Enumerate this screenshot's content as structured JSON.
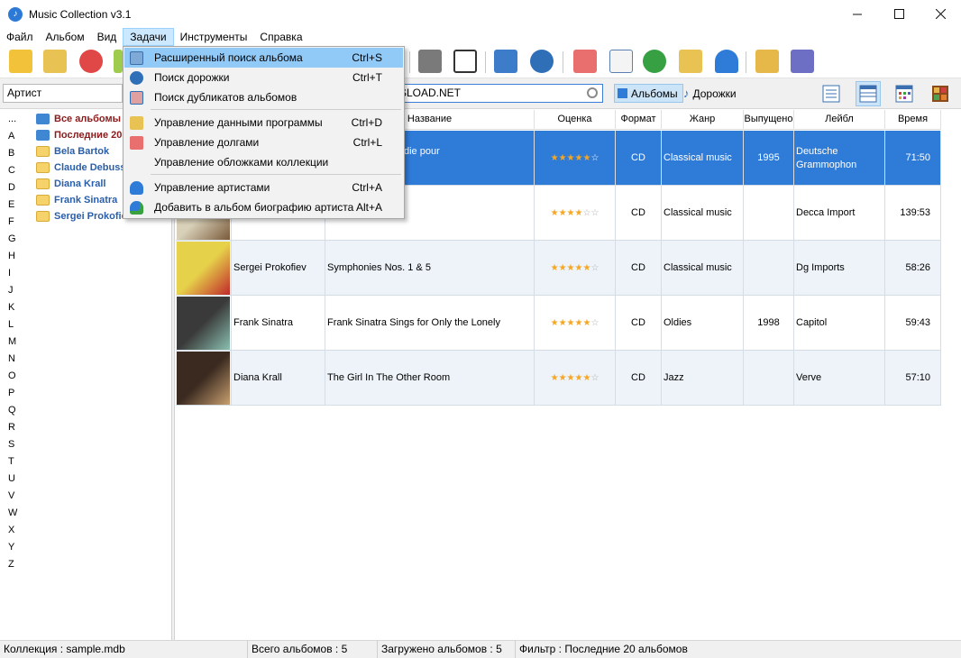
{
  "window": {
    "title": "Music Collection v3.1"
  },
  "menu": [
    "Файл",
    "Альбом",
    "Вид",
    "Задачи",
    "Инструменты",
    "Справка"
  ],
  "tasks_menu": [
    {
      "label": "Расширенный поиск альбома",
      "shortcut": "Ctrl+S",
      "icon": "advanced-search-icon"
    },
    {
      "label": "Поиск дорожки",
      "shortcut": "Ctrl+T",
      "icon": "track-search-icon"
    },
    {
      "label": "Поиск дубликатов альбомов",
      "shortcut": "",
      "icon": "duplicate-search-icon"
    },
    {
      "label": "Управление данными программы",
      "shortcut": "Ctrl+D",
      "icon": "data-manager-icon"
    },
    {
      "label": "Управление долгами",
      "shortcut": "Ctrl+L",
      "icon": "loans-icon"
    },
    {
      "label": "Управление обложками коллекции",
      "shortcut": "",
      "icon": "covers-icon"
    },
    {
      "label": "Управление артистами",
      "shortcut": "Ctrl+A",
      "icon": "artist-icon"
    },
    {
      "label": "Добавить в альбом биографию артиста",
      "shortcut": "Alt+A",
      "icon": "add-biography-icon"
    }
  ],
  "search": {
    "field_combo": "Артист",
    "text": "SLOAD.NET",
    "mode_albums": "Альбомы",
    "mode_tracks": "Дорожки"
  },
  "letters": [
    "...",
    "A",
    "B",
    "C",
    "D",
    "E",
    "F",
    "G",
    "H",
    "I",
    "J",
    "K",
    "L",
    "M",
    "N",
    "O",
    "P",
    "Q",
    "R",
    "S",
    "T",
    "U",
    "V",
    "W",
    "X",
    "Y",
    "Z"
  ],
  "tree": [
    {
      "label": "Все альбомы",
      "color": "#8b1a1a",
      "icon": "blue-folder-icon"
    },
    {
      "label": "Последние 20",
      "color": "#8b1a1a",
      "icon": "blue-folder-icon"
    },
    {
      "label": "Bela Bartok",
      "color": "#2a5ea8",
      "icon": "folder-icon"
    },
    {
      "label": "Claude Debussy",
      "color": "#2a5ea8",
      "icon": "folder-icon"
    },
    {
      "label": "Diana Krall",
      "color": "#2a5ea8",
      "icon": "folder-icon"
    },
    {
      "label": "Frank Sinatra",
      "color": "#2a5ea8",
      "icon": "folder-icon"
    },
    {
      "label": "Sergei Prokofiev",
      "color": "#2a5ea8",
      "icon": "folder-icon"
    }
  ],
  "columns": [
    "",
    "",
    "Название",
    "Оценка",
    "Формат",
    "Жанр",
    "Выпущено",
    "Лейбл",
    "Время"
  ],
  "rows": [
    {
      "artist": "",
      "title": "s / Jeux / Rhapsodie pour\nestre",
      "rating": 5,
      "format": "CD",
      "genre": "Classical music",
      "year": "1995",
      "label": "Deutsche\nGrammophon",
      "time": "71:50",
      "selected": true
    },
    {
      "artist": "",
      "title": "asterpieces",
      "rating": 4,
      "format": "CD",
      "genre": "Classical music",
      "year": "",
      "label": "Decca Import",
      "time": "139:53",
      "selected": false
    },
    {
      "artist": "Sergei Prokofiev",
      "title": "Symphonies Nos. 1 & 5",
      "rating": 5,
      "format": "CD",
      "genre": "Classical music",
      "year": "",
      "label": "Dg Imports",
      "time": "58:26",
      "selected": false
    },
    {
      "artist": "Frank Sinatra",
      "title": "Frank Sinatra Sings for Only the Lonely",
      "rating": 5,
      "format": "CD",
      "genre": "Oldies",
      "year": "1998",
      "label": "Capitol",
      "time": "59:43",
      "selected": false
    },
    {
      "artist": "Diana Krall",
      "title": "The Girl In The Other Room",
      "rating": 5,
      "format": "CD",
      "genre": "Jazz",
      "year": "",
      "label": "Verve",
      "time": "57:10",
      "selected": false
    }
  ],
  "status": {
    "collection": "Коллекция : sample.mdb",
    "total": "Всего альбомов : 5",
    "loaded": "Загружено альбомов : 5",
    "filter": "Фильтр : Последние 20 альбомов"
  }
}
